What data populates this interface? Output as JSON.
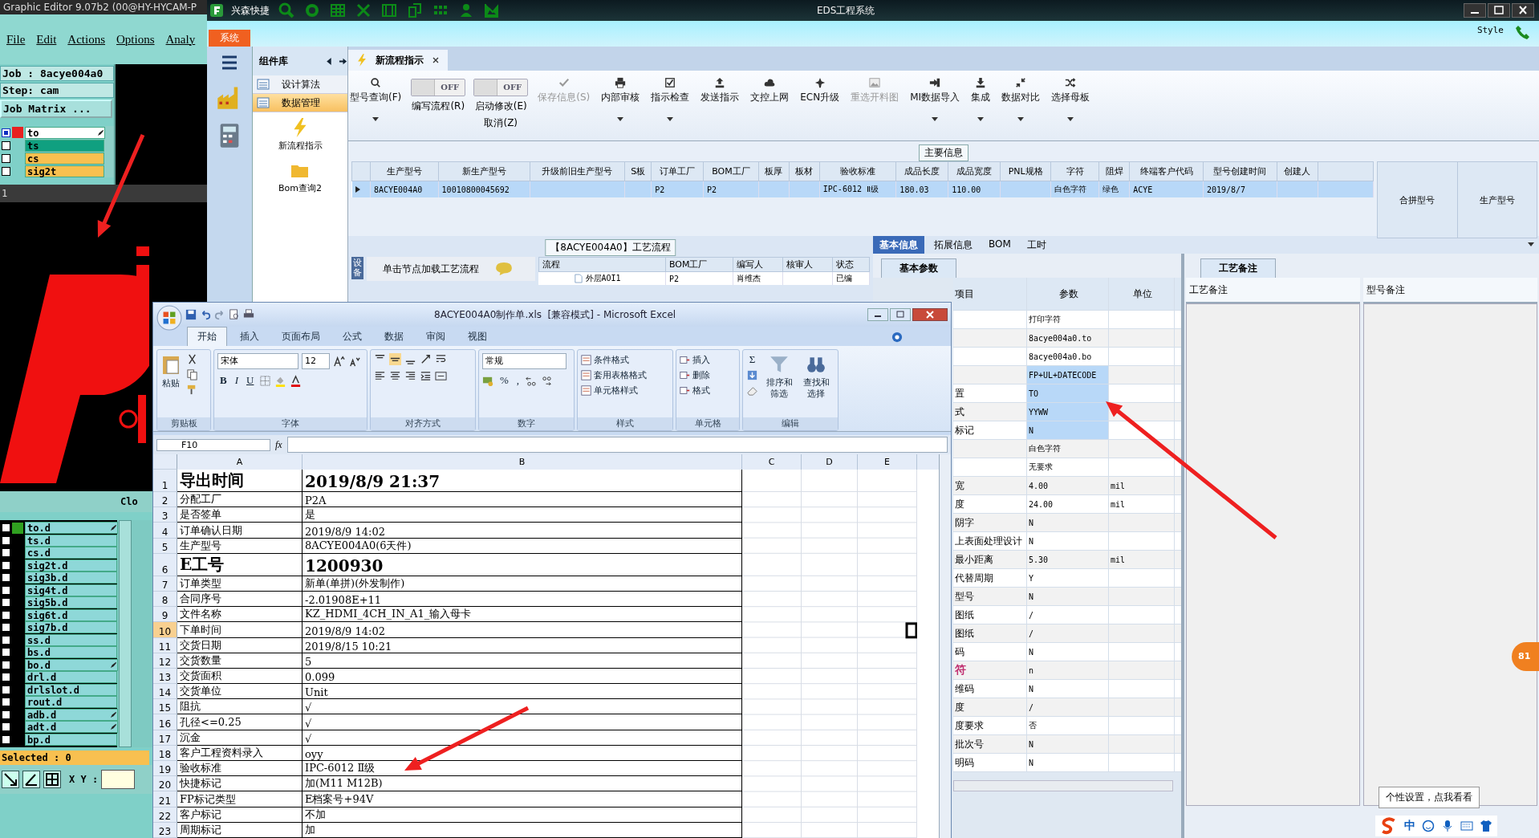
{
  "graphic_editor": {
    "title": "Graphic Editor 9.07b2 (00@HY-HYCAM-P",
    "menu": [
      "File",
      "Edit",
      "Actions",
      "Options",
      "Analy"
    ],
    "job": "Job : 8acye004a0",
    "step": "Step: cam",
    "job_matrix": "Job Matrix ...",
    "top_layers": [
      {
        "name": "to",
        "color": "#ffffff",
        "highlighted": true,
        "selected": true,
        "marked": true
      },
      {
        "name": "ts",
        "color": "#10a080",
        "highlighted": false,
        "selected": false,
        "marked": false
      },
      {
        "name": "cs",
        "color": "#f8c050",
        "highlighted": false,
        "selected": false,
        "marked": false
      },
      {
        "name": "sig2t",
        "color": "#f8c050",
        "highlighted": false,
        "selected": false,
        "marked": false
      }
    ],
    "row_number": "1",
    "close_label": "Clo",
    "bottom_layers": [
      {
        "name": "to.d",
        "highlighted": true,
        "selected": false,
        "marked": true
      },
      {
        "name": "ts.d",
        "highlighted": false,
        "selected": false,
        "marked": false
      },
      {
        "name": "cs.d",
        "highlighted": false,
        "selected": false,
        "marked": false
      },
      {
        "name": "sig2t.d",
        "highlighted": false,
        "selected": false,
        "marked": false
      },
      {
        "name": "sig3b.d",
        "highlighted": false,
        "selected": false,
        "marked": false
      },
      {
        "name": "sig4t.d",
        "highlighted": false,
        "selected": false,
        "marked": false
      },
      {
        "name": "sig5b.d",
        "highlighted": false,
        "selected": false,
        "marked": false
      },
      {
        "name": "sig6t.d",
        "highlighted": false,
        "selected": false,
        "marked": false
      },
      {
        "name": "sig7b.d",
        "highlighted": false,
        "selected": false,
        "marked": false
      },
      {
        "name": "ss.d",
        "highlighted": false,
        "selected": false,
        "marked": false
      },
      {
        "name": "bs.d",
        "highlighted": false,
        "selected": false,
        "marked": false
      },
      {
        "name": "bo.d",
        "highlighted": false,
        "selected": false,
        "marked": true
      },
      {
        "name": "drl.d",
        "highlighted": false,
        "selected": false,
        "marked": false
      },
      {
        "name": "drlslot.d",
        "highlighted": false,
        "selected": false,
        "marked": false
      },
      {
        "name": "rout.d",
        "highlighted": false,
        "selected": false,
        "marked": false
      },
      {
        "name": "adb.d",
        "highlighted": false,
        "selected": false,
        "marked": true
      },
      {
        "name": "adt.d",
        "highlighted": false,
        "selected": false,
        "marked": true
      },
      {
        "name": "bp.d",
        "highlighted": false,
        "selected": false,
        "marked": false
      }
    ],
    "selected_count": "Selected : 0",
    "xy_label": "X Y :"
  },
  "eds": {
    "title": "EDS工程系统",
    "quick_label": "兴森快捷",
    "system_tab": "系统",
    "style_label": "Style",
    "nav": {
      "header": "组件库",
      "items": [
        {
          "label": "设计算法",
          "kind": "row",
          "selected": false
        },
        {
          "label": "数据管理",
          "kind": "row",
          "selected": true
        },
        {
          "label": "新流程指示",
          "kind": "tile",
          "selected": false
        },
        {
          "label": "Bom查询2",
          "kind": "tile",
          "selected": false
        }
      ]
    },
    "tab": {
      "label": "新流程指示",
      "selected": true
    },
    "toolbar": [
      {
        "label": "型号查询(F)",
        "kind": "button",
        "disabled": false,
        "dropdown": true
      },
      {
        "label": "编写流程(R)",
        "kind": "toggle",
        "on": false,
        "state_text": "OFF"
      },
      {
        "label": "启动修改(E)",
        "kind": "toggle",
        "on": false,
        "state_text": "OFF",
        "sub_label": "取消(Z)"
      },
      {
        "label": "保存信息(S)",
        "kind": "button",
        "disabled": true,
        "dropdown": false
      },
      {
        "label": "内部审核",
        "kind": "button",
        "disabled": false,
        "dropdown": true
      },
      {
        "label": "指示检查",
        "kind": "button",
        "disabled": false,
        "dropdown": true
      },
      {
        "label": "发送指示",
        "kind": "button",
        "disabled": false,
        "dropdown": false
      },
      {
        "label": "文控上网",
        "kind": "button",
        "disabled": false,
        "dropdown": false
      },
      {
        "label": "ECN升级",
        "kind": "button",
        "disabled": false,
        "dropdown": false
      },
      {
        "label": "重选开料图",
        "kind": "button",
        "disabled": true,
        "dropdown": false
      },
      {
        "label": "MI数据导入",
        "kind": "button",
        "disabled": false,
        "dropdown": true
      },
      {
        "label": "集成",
        "kind": "button",
        "disabled": false,
        "dropdown": true
      },
      {
        "label": "数据对比",
        "kind": "button",
        "disabled": false,
        "dropdown": true
      },
      {
        "label": "选择母板",
        "kind": "button",
        "disabled": false,
        "dropdown": true
      }
    ],
    "main_info": {
      "legend": "主要信息",
      "columns": [
        "生产型号",
        "新生产型号",
        "升级前旧生产型号",
        "S板",
        "订单工厂",
        "BOM工厂",
        "板厚",
        "板材",
        "验收标准",
        "成品长度",
        "成品宽度",
        "PNL规格",
        "字符",
        "阻焊",
        "终端客户代码",
        "型号创建时间",
        "创建人"
      ],
      "rows": [
        {
          "selected": true,
          "cells": [
            "8ACYE004A0",
            "10010800045692",
            "",
            "",
            "P2",
            "P2",
            "",
            "",
            "IPC-6012 Ⅱ级",
            "180.03",
            "110.00",
            "",
            "白色字符",
            "绿色",
            "ACYE",
            "2019/8/7",
            ""
          ]
        }
      ],
      "merge_columns": [
        "合拼型号",
        "生产型号"
      ]
    },
    "process": {
      "legend": "【8ACYE004A0】工艺流程",
      "side_tab": "设备",
      "hint": "单击节点加载工艺流程",
      "columns": [
        "流程",
        "BOM工厂",
        "编写人",
        "核审人",
        "状态"
      ],
      "rows": [
        [
          "外层AOI1",
          "P2",
          "肖维杰",
          "",
          "已编"
        ]
      ]
    },
    "info_tabs": [
      {
        "label": "基本信息",
        "selected": true
      },
      {
        "label": "拓展信息",
        "selected": false
      },
      {
        "label": "BOM",
        "selected": false
      },
      {
        "label": "工时",
        "selected": false
      }
    ],
    "params": {
      "tab": "基本参数",
      "columns": [
        "项目",
        "参数",
        "单位"
      ],
      "rows": [
        {
          "value": "打印字符",
          "selected": false
        },
        {
          "value": "8acye004a0.to",
          "selected": false
        },
        {
          "value": "8acye004a0.bo",
          "selected": false
        },
        {
          "value": "FP+UL+DATECODE",
          "selected": true
        },
        {
          "item": "置",
          "value": "TO",
          "selected": true
        },
        {
          "item": "式",
          "value": "YYWW",
          "selected": true
        },
        {
          "item": "标记",
          "value": "N",
          "selected": true
        },
        {
          "value": "白色字符",
          "selected": false
        },
        {
          "value": "无要求",
          "selected": false
        },
        {
          "item": "宽",
          "value": "4.00",
          "unit": "mil",
          "selected": false
        },
        {
          "item": "度",
          "value": "24.00",
          "unit": "mil",
          "selected": false
        },
        {
          "item": "阴字",
          "value": "N",
          "selected": false
        },
        {
          "item": "上表面处理设计",
          "value": "N",
          "selected": false
        },
        {
          "item": "最小距离",
          "value": "5.30",
          "unit": "mil",
          "selected": false
        },
        {
          "item": "代替周期",
          "value": "Y",
          "selected": false
        },
        {
          "item": "型号",
          "value": "N",
          "selected": false
        },
        {
          "item": "图纸",
          "value": "/",
          "selected": false
        },
        {
          "item": "图纸",
          "value": "/",
          "selected": false
        },
        {
          "item": "码",
          "value": "N",
          "selected": false
        },
        {
          "item": "符",
          "value": "n",
          "selected": false,
          "color": "#c03070"
        },
        {
          "item": "维码",
          "value": "N",
          "selected": false
        },
        {
          "item": "度",
          "value": "/",
          "selected": false
        },
        {
          "item": "度要求",
          "value": "否",
          "selected": false
        },
        {
          "item": "批次号",
          "value": "N",
          "selected": false
        },
        {
          "item": "明码",
          "value": "N",
          "selected": false
        }
      ]
    },
    "remarks": {
      "tab": "工艺备注",
      "columns": [
        "工艺备注",
        "型号备注"
      ]
    },
    "tooltip": "个性设置，点我看看",
    "badge": "81",
    "ime": "中"
  },
  "excel": {
    "title": "8ACYE004A0制作单.xls  [兼容模式] - Microsoft Excel",
    "tabs": [
      {
        "label": "开始",
        "selected": true
      },
      {
        "label": "插入",
        "selected": false
      },
      {
        "label": "页面布局",
        "selected": false
      },
      {
        "label": "公式",
        "selected": false
      },
      {
        "label": "数据",
        "selected": false
      },
      {
        "label": "审阅",
        "selected": false
      },
      {
        "label": "视图",
        "selected": false
      }
    ],
    "ribbon": {
      "paste": "粘贴",
      "font_name": "宋体",
      "font_size": "12",
      "font_buttons": [
        "B",
        "I",
        "U"
      ],
      "number_format": "常规",
      "number_buttons": [
        "%",
        ","
      ],
      "style_items": [
        "条件格式",
        "套用表格格式",
        "单元格样式"
      ],
      "cell_items": [
        "插入",
        "删除",
        "格式"
      ],
      "sum": "Σ",
      "edit_items": [
        "排序和筛选",
        "查找和选择"
      ],
      "groups": [
        "剪贴板",
        "字体",
        "对齐方式",
        "数字",
        "样式",
        "单元格",
        "编辑"
      ]
    },
    "name_box": "F10",
    "fx": "fx",
    "columns": [
      "A",
      "B",
      "C",
      "D",
      "E"
    ],
    "rows": [
      {
        "n": "1",
        "a": "导出时间",
        "b": "2019/8/9 21:37",
        "big": true,
        "selected": false
      },
      {
        "n": "2",
        "a": "分配工厂",
        "b": "P2A",
        "big": false,
        "selected": false
      },
      {
        "n": "3",
        "a": "是否签单",
        "b": "是",
        "big": false,
        "selected": false
      },
      {
        "n": "4",
        "a": "订单确认日期",
        "b": "2019/8/9 14:02",
        "big": false,
        "selected": false
      },
      {
        "n": "5",
        "a": "生产型号",
        "b": "8ACYE004A0(6天件)",
        "big": false,
        "selected": false
      },
      {
        "n": "6",
        "a": "E工号",
        "b": "1200930",
        "big": true,
        "selected": false
      },
      {
        "n": "7",
        "a": "订单类型",
        "b": "新单(单拼)(外发制作)",
        "big": false,
        "selected": false
      },
      {
        "n": "8",
        "a": "合同序号",
        "b": "-2.01908E+11",
        "big": false,
        "selected": false
      },
      {
        "n": "9",
        "a": "文件名称",
        "b": "KZ_HDMI_4CH_IN_A1_输入母卡",
        "big": false,
        "selected": false
      },
      {
        "n": "10",
        "a": "下单时间",
        "b": "2019/8/9 14:02",
        "big": false,
        "selected": true
      },
      {
        "n": "11",
        "a": "交货日期",
        "b": "2019/8/15 10:21",
        "big": false,
        "selected": false
      },
      {
        "n": "12",
        "a": "交货数量",
        "b": "5",
        "big": false,
        "selected": false
      },
      {
        "n": "13",
        "a": "交货面积",
        "b": "0.099",
        "big": false,
        "selected": false
      },
      {
        "n": "14",
        "a": "交货单位",
        "b": "Unit",
        "big": false,
        "selected": false
      },
      {
        "n": "15",
        "a": "阻抗",
        "b": "√",
        "big": false,
        "selected": false
      },
      {
        "n": "16",
        "a": "孔径<=0.25",
        "b": "√",
        "big": false,
        "selected": false
      },
      {
        "n": "17",
        "a": "沉金",
        "b": "√",
        "big": false,
        "selected": false
      },
      {
        "n": "18",
        "a": "客户工程资料录入",
        "b": "oyy",
        "big": false,
        "selected": false
      },
      {
        "n": "19",
        "a": "验收标准",
        "b": "IPC-6012 Ⅱ级",
        "big": false,
        "selected": false
      },
      {
        "n": "20",
        "a": "快捷标记",
        "b": "加(M11 M12B)",
        "big": false,
        "selected": false
      },
      {
        "n": "21",
        "a": "FP标记类型",
        "b": "E档案号+94V",
        "big": false,
        "selected": false
      },
      {
        "n": "22",
        "a": "客户标记",
        "b": "不加",
        "big": false,
        "selected": false
      },
      {
        "n": "23",
        "a": "周期标记",
        "b": "加",
        "big": false,
        "selected": false
      }
    ]
  }
}
